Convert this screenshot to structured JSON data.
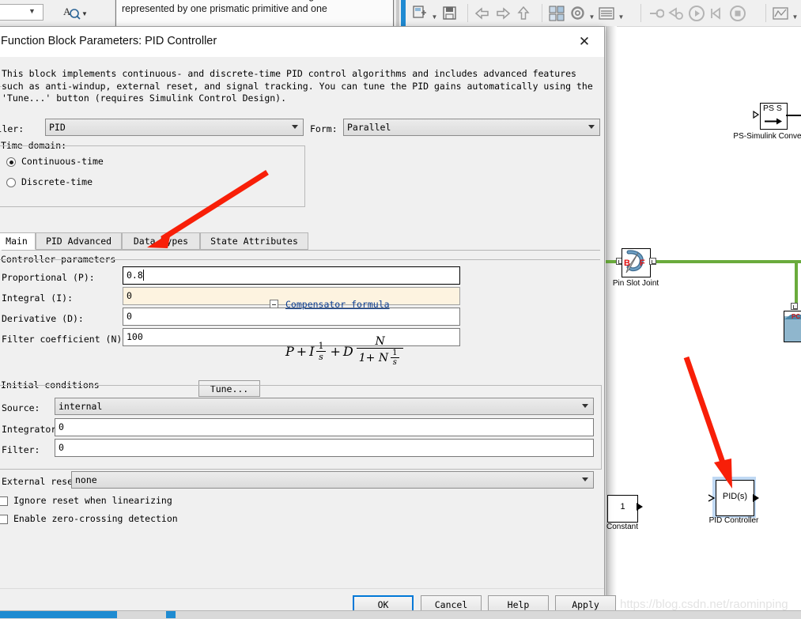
{
  "model_window": {
    "toolbar": {
      "search_placeholder": "",
      "search_value": "",
      "icons": [
        "new-model-icon",
        "save-icon",
        "back-icon",
        "forward-icon",
        "up-icon",
        "library-browser-icon",
        "model-settings-icon",
        "model-explorer-icon",
        "update-model-icon",
        "fast-restart-icon",
        "run-icon",
        "step-forward-icon",
        "stop-icon",
        "scope-icon"
      ]
    },
    "tooltip": {
      "text": "Represents a pin slot joint between two frames. This joint has one translational and one rotational degree of freedom represented by one prismatic primitive and one"
    },
    "blocks": [
      {
        "name": "PS-Simulink Converter",
        "inner": "PS S"
      },
      {
        "name": "Pin Slot Joint",
        "port_b": "B",
        "port_f": "F"
      },
      {
        "name": "Constant",
        "inner": "1"
      },
      {
        "name": "PID Controller",
        "inner": "PID(s)",
        "selected": true
      }
    ],
    "signal_color": "#6aab3c"
  },
  "dialog": {
    "title": "Function Block Parameters: PID Controller",
    "close_label": "✕",
    "group_title": "PID Controller",
    "description": "This block implements continuous- and discrete-time PID control algorithms and includes advanced features such as anti-windup, external reset, and signal tracking. You can tune the PID gains automatically using the 'Tune...' button (requires Simulink Control Design).",
    "controller": {
      "label": "Controller:",
      "value": "PID"
    },
    "form": {
      "label": "Form:",
      "value": "Parallel"
    },
    "time_domain": {
      "title": "Time domain:",
      "options": [
        {
          "label": "Continuous-time",
          "selected": true
        },
        {
          "label": "Discrete-time",
          "selected": false
        }
      ]
    },
    "tabs": [
      {
        "label": "Main",
        "active": true
      },
      {
        "label": "PID Advanced",
        "active": false
      },
      {
        "label": "Data Types",
        "active": false
      },
      {
        "label": "State Attributes",
        "active": false
      }
    ],
    "controller_parameters": {
      "title": "Controller parameters",
      "fields": [
        {
          "label": "Proportional (P):",
          "value": "0.8",
          "state": "focus"
        },
        {
          "label": "Integral (I):",
          "value": "0",
          "state": "modified"
        },
        {
          "label": "Derivative (D):",
          "value": "0",
          "state": "normal"
        },
        {
          "label": "Filter coefficient (N):",
          "value": "100",
          "state": "normal"
        }
      ],
      "tune_button": "Tune..."
    },
    "compensator": {
      "link": "Compensator formula",
      "formula_parts": {
        "p": "P",
        "plus1": "+",
        "i": "I",
        "one": "1",
        "s": "s",
        "plus2": "+",
        "d": "D",
        "n": "N",
        "one_plus_n": "1+ N"
      }
    },
    "initial_conditions": {
      "title": "Initial conditions",
      "source": {
        "label": "Source:",
        "value": "internal"
      },
      "integrator": {
        "label": "Integrator:",
        "value": "0"
      },
      "filter": {
        "label": "Filter:",
        "value": "0"
      }
    },
    "external_reset": {
      "label": "External reset:",
      "value": "none"
    },
    "checkboxes": [
      {
        "label": "Ignore reset when linearizing",
        "checked": false
      },
      {
        "label": "Enable zero-crossing detection",
        "checked": false
      }
    ],
    "buttons": [
      {
        "label": "OK",
        "default": true
      },
      {
        "label": "Cancel",
        "default": false
      },
      {
        "label": "Help",
        "default": false
      },
      {
        "label": "Apply",
        "default": false
      }
    ]
  },
  "annotations": {
    "arrow_color": "#f81f08",
    "arrow1_name": "red-arrow-to-proportional-field",
    "arrow2_name": "red-arrow-to-pid-controller-block"
  },
  "watermark": "https://blog.csdn.net/raominping"
}
